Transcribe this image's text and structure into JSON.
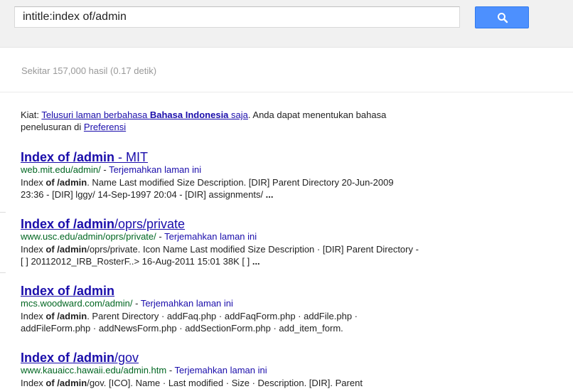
{
  "search": {
    "query": "intitle:index of/admin"
  },
  "stats": {
    "text": "Sekitar 157,000 hasil (0.17 detik)"
  },
  "tip": {
    "prefix": "Kiat: ",
    "link_part1": "Telusuri laman berbahasa ",
    "link_bold": "Bahasa Indonesia",
    "link_part2": " saja",
    "middle": ". Anda dapat menentukan bahasa penelusuran di ",
    "pref_link": "Preferensi"
  },
  "results": [
    {
      "title_bold": "Index of /admin",
      "title_rest": " - MIT",
      "url": "web.mit.edu/admin/",
      "sep": " - ",
      "translate": "Terjemahkan laman ini",
      "snippet": [
        {
          "t": "Index ",
          "b": false
        },
        {
          "t": "of /admin",
          "b": true
        },
        {
          "t": ". Name Last modified Size Description. [DIR] Parent Directory 20-Jun-2009 23:36 - [DIR] lggy/ 14-Sep-1997 20:04 - [DIR] assignments/ ",
          "b": false
        },
        {
          "t": "...",
          "b": true
        }
      ]
    },
    {
      "title_bold": "Index of /admin",
      "title_rest": "/oprs/private",
      "url": "www.usc.edu/admin/oprs/private/",
      "sep": " - ",
      "translate": "Terjemahkan laman ini",
      "snippet": [
        {
          "t": "Index ",
          "b": false
        },
        {
          "t": "of /admin",
          "b": true
        },
        {
          "t": "/oprs/private. Icon Name Last modified Size Description · [DIR] Parent Directory - [ ] 20112012_IRB_RosterF..> 16-Aug-2011 15:01 38K [ ] ",
          "b": false
        },
        {
          "t": "...",
          "b": true
        }
      ]
    },
    {
      "title_bold": "Index of /admin",
      "title_rest": "",
      "url": "mcs.woodward.com/admin/",
      "sep": " - ",
      "translate": "Terjemahkan laman ini",
      "snippet": [
        {
          "t": "Index ",
          "b": false
        },
        {
          "t": "of /admin",
          "b": true
        },
        {
          "t": ". Parent Directory · addFaq.php · addFaqForm.php · addFile.php · addFileForm.php · addNewsForm.php · addSectionForm.php · add_item_form.",
          "b": false
        }
      ]
    },
    {
      "title_bold": "Index of /admin",
      "title_rest": "/gov",
      "url": "www.kauaicc.hawaii.edu/admin.htm",
      "sep": " - ",
      "translate": "Terjemahkan laman ini",
      "snippet": [
        {
          "t": "Index ",
          "b": false
        },
        {
          "t": "of /admin",
          "b": true
        },
        {
          "t": "/gov. [ICO]. Name · Last modified · Size · Description. [DIR]. Parent",
          "b": false
        }
      ]
    }
  ],
  "colors": {
    "link": "#1a0dab",
    "url": "#006621",
    "button": "#4d90fe",
    "header_bg": "#f1f1f1"
  }
}
